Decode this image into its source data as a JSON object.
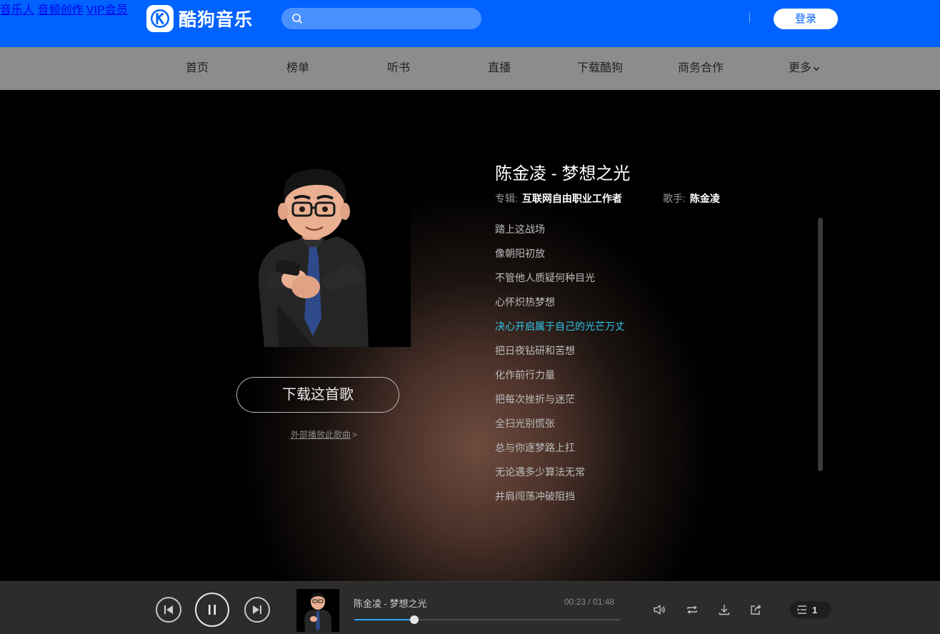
{
  "header": {
    "logo_text": "酷狗音乐",
    "search_placeholder": "",
    "links": [
      "音乐人",
      "音频创作",
      "VIP会员"
    ],
    "login_label": "登录"
  },
  "nav": {
    "items": [
      "首页",
      "榜单",
      "听书",
      "直播",
      "下载酷狗",
      "商务合作",
      "更多"
    ]
  },
  "song": {
    "title": "陈金凌 - 梦想之光",
    "album_label": "专辑:",
    "album": "互联网自由职业工作者",
    "singer_label": "歌手:",
    "singer": "陈金凌",
    "download_label": "下载这首歌",
    "external_play_label": "外部播放此歌曲",
    "external_play_arrow": ">"
  },
  "lyrics": {
    "lines": [
      "踏上这战场",
      "像朝阳初放",
      "不管他人质疑何种目光",
      "心怀炽热梦想",
      "决心开启属于自己的光芒万丈",
      "把日夜钻研和苦想",
      "化作前行力量",
      "把每次挫折与迷茫",
      "全扫光别慌张",
      "总与你逐梦路上扛",
      "无论遇多少算法无常",
      "并肩闯荡冲破阻挡"
    ],
    "active_index": 4
  },
  "player": {
    "title": "陈金凌 - 梦想之光",
    "time": "00:23 / 01:48",
    "progress": 0.225,
    "queue_count": "1",
    "icons": [
      "prev-icon",
      "pause-icon",
      "next-icon",
      "volume-icon",
      "loop-icon",
      "download-icon",
      "share-icon",
      "playlist-icon"
    ]
  },
  "colors": {
    "brand": "#0062ff",
    "active_lyric": "#2fc6e8",
    "progress": "#2ba6ff"
  }
}
